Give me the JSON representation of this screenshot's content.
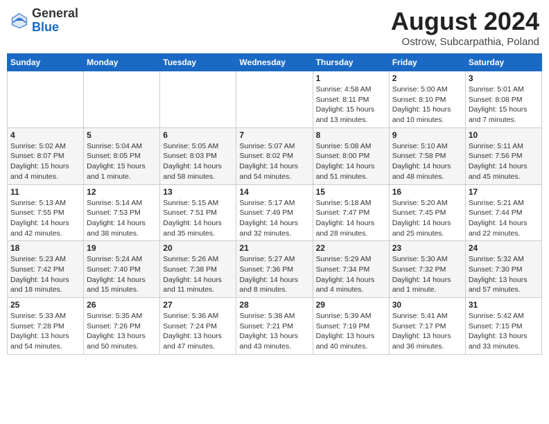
{
  "header": {
    "logo_general": "General",
    "logo_blue": "Blue",
    "month_title": "August 2024",
    "subtitle": "Ostrow, Subcarpathia, Poland"
  },
  "weekdays": [
    "Sunday",
    "Monday",
    "Tuesday",
    "Wednesday",
    "Thursday",
    "Friday",
    "Saturday"
  ],
  "weeks": [
    [
      {
        "day": "",
        "info": ""
      },
      {
        "day": "",
        "info": ""
      },
      {
        "day": "",
        "info": ""
      },
      {
        "day": "",
        "info": ""
      },
      {
        "day": "1",
        "info": "Sunrise: 4:58 AM\nSunset: 8:11 PM\nDaylight: 15 hours\nand 13 minutes."
      },
      {
        "day": "2",
        "info": "Sunrise: 5:00 AM\nSunset: 8:10 PM\nDaylight: 15 hours\nand 10 minutes."
      },
      {
        "day": "3",
        "info": "Sunrise: 5:01 AM\nSunset: 8:08 PM\nDaylight: 15 hours\nand 7 minutes."
      }
    ],
    [
      {
        "day": "4",
        "info": "Sunrise: 5:02 AM\nSunset: 8:07 PM\nDaylight: 15 hours\nand 4 minutes."
      },
      {
        "day": "5",
        "info": "Sunrise: 5:04 AM\nSunset: 8:05 PM\nDaylight: 15 hours\nand 1 minute."
      },
      {
        "day": "6",
        "info": "Sunrise: 5:05 AM\nSunset: 8:03 PM\nDaylight: 14 hours\nand 58 minutes."
      },
      {
        "day": "7",
        "info": "Sunrise: 5:07 AM\nSunset: 8:02 PM\nDaylight: 14 hours\nand 54 minutes."
      },
      {
        "day": "8",
        "info": "Sunrise: 5:08 AM\nSunset: 8:00 PM\nDaylight: 14 hours\nand 51 minutes."
      },
      {
        "day": "9",
        "info": "Sunrise: 5:10 AM\nSunset: 7:58 PM\nDaylight: 14 hours\nand 48 minutes."
      },
      {
        "day": "10",
        "info": "Sunrise: 5:11 AM\nSunset: 7:56 PM\nDaylight: 14 hours\nand 45 minutes."
      }
    ],
    [
      {
        "day": "11",
        "info": "Sunrise: 5:13 AM\nSunset: 7:55 PM\nDaylight: 14 hours\nand 42 minutes."
      },
      {
        "day": "12",
        "info": "Sunrise: 5:14 AM\nSunset: 7:53 PM\nDaylight: 14 hours\nand 38 minutes."
      },
      {
        "day": "13",
        "info": "Sunrise: 5:15 AM\nSunset: 7:51 PM\nDaylight: 14 hours\nand 35 minutes."
      },
      {
        "day": "14",
        "info": "Sunrise: 5:17 AM\nSunset: 7:49 PM\nDaylight: 14 hours\nand 32 minutes."
      },
      {
        "day": "15",
        "info": "Sunrise: 5:18 AM\nSunset: 7:47 PM\nDaylight: 14 hours\nand 28 minutes."
      },
      {
        "day": "16",
        "info": "Sunrise: 5:20 AM\nSunset: 7:45 PM\nDaylight: 14 hours\nand 25 minutes."
      },
      {
        "day": "17",
        "info": "Sunrise: 5:21 AM\nSunset: 7:44 PM\nDaylight: 14 hours\nand 22 minutes."
      }
    ],
    [
      {
        "day": "18",
        "info": "Sunrise: 5:23 AM\nSunset: 7:42 PM\nDaylight: 14 hours\nand 18 minutes."
      },
      {
        "day": "19",
        "info": "Sunrise: 5:24 AM\nSunset: 7:40 PM\nDaylight: 14 hours\nand 15 minutes."
      },
      {
        "day": "20",
        "info": "Sunrise: 5:26 AM\nSunset: 7:38 PM\nDaylight: 14 hours\nand 11 minutes."
      },
      {
        "day": "21",
        "info": "Sunrise: 5:27 AM\nSunset: 7:36 PM\nDaylight: 14 hours\nand 8 minutes."
      },
      {
        "day": "22",
        "info": "Sunrise: 5:29 AM\nSunset: 7:34 PM\nDaylight: 14 hours\nand 4 minutes."
      },
      {
        "day": "23",
        "info": "Sunrise: 5:30 AM\nSunset: 7:32 PM\nDaylight: 14 hours\nand 1 minute."
      },
      {
        "day": "24",
        "info": "Sunrise: 5:32 AM\nSunset: 7:30 PM\nDaylight: 13 hours\nand 57 minutes."
      }
    ],
    [
      {
        "day": "25",
        "info": "Sunrise: 5:33 AM\nSunset: 7:28 PM\nDaylight: 13 hours\nand 54 minutes."
      },
      {
        "day": "26",
        "info": "Sunrise: 5:35 AM\nSunset: 7:26 PM\nDaylight: 13 hours\nand 50 minutes."
      },
      {
        "day": "27",
        "info": "Sunrise: 5:36 AM\nSunset: 7:24 PM\nDaylight: 13 hours\nand 47 minutes."
      },
      {
        "day": "28",
        "info": "Sunrise: 5:38 AM\nSunset: 7:21 PM\nDaylight: 13 hours\nand 43 minutes."
      },
      {
        "day": "29",
        "info": "Sunrise: 5:39 AM\nSunset: 7:19 PM\nDaylight: 13 hours\nand 40 minutes."
      },
      {
        "day": "30",
        "info": "Sunrise: 5:41 AM\nSunset: 7:17 PM\nDaylight: 13 hours\nand 36 minutes."
      },
      {
        "day": "31",
        "info": "Sunrise: 5:42 AM\nSunset: 7:15 PM\nDaylight: 13 hours\nand 33 minutes."
      }
    ]
  ]
}
